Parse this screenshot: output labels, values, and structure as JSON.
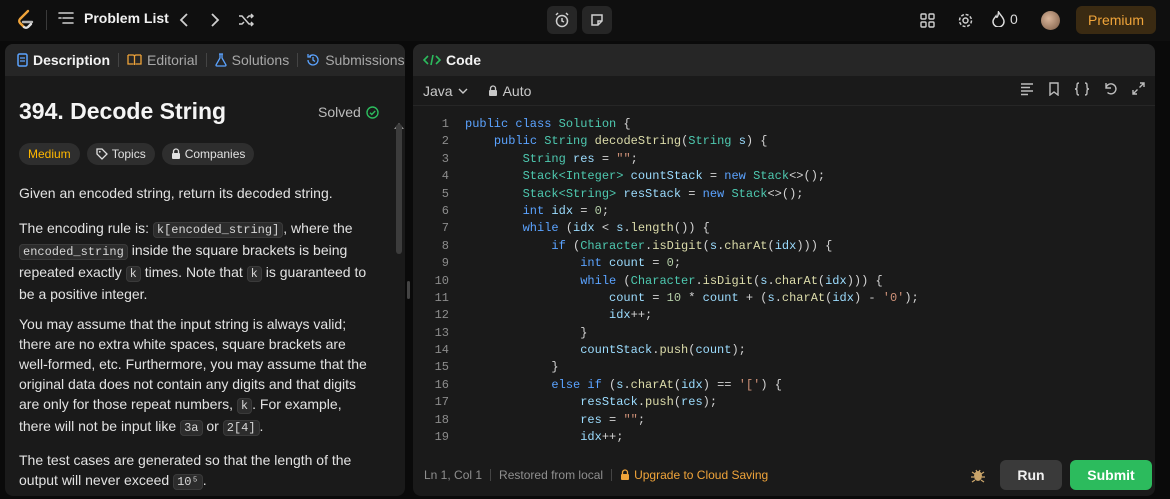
{
  "topbar": {
    "problem_list_label": "Problem List",
    "streak_count": "0",
    "premium_label": "Premium"
  },
  "left_tabs": {
    "description": "Description",
    "editorial": "Editorial",
    "solutions": "Solutions",
    "submissions": "Submissions"
  },
  "problem": {
    "title": "394. Decode String",
    "status": "Solved",
    "difficulty": "Medium",
    "topics_label": "Topics",
    "companies_label": "Companies",
    "p1": "Given an encoded string, return its decoded string.",
    "p2_a": "The encoding rule is: ",
    "p2_code1": "k[encoded_string]",
    "p2_b": ", where the ",
    "p2_code2": "encoded_string",
    "p2_c": " inside the square brackets is being repeated exactly ",
    "p2_code3": "k",
    "p2_d": " times. Note that ",
    "p2_code4": "k",
    "p2_e": " is guaranteed to be a positive integer.",
    "p3_a": "You may assume that the input string is always valid; there are no extra white spaces, square brackets are well-formed, etc. Furthermore, you may assume that the original data does not contain any digits and that digits are only for those repeat numbers, ",
    "p3_code1": "k",
    "p3_b": ". For example, there will not be input like ",
    "p3_code2": "3a",
    "p3_c": " or ",
    "p3_code3": "2[4]",
    "p3_d": ".",
    "p4_a": "The test cases are generated so that the length of the output will never exceed ",
    "p4_code": "10⁵",
    "p4_b": "."
  },
  "editor": {
    "tab_label": "Code",
    "language": "Java",
    "mode": "Auto",
    "line_numbers": [
      "1",
      "2",
      "3",
      "4",
      "5",
      "6",
      "7",
      "8",
      "9",
      "10",
      "11",
      "12",
      "13",
      "14",
      "15",
      "16",
      "17",
      "18",
      "19"
    ]
  },
  "status_bar": {
    "position": "Ln 1, Col 1",
    "restored": "Restored from local",
    "upgrade": "Upgrade to Cloud Saving",
    "run_label": "Run",
    "submit_label": "Submit"
  },
  "colors": {
    "accent_green": "#2cbb5d",
    "medium_yellow": "#ffb800",
    "premium_orange": "#f0a43a"
  },
  "icons": [
    "logo-icon",
    "list-icon",
    "chevron-left-icon",
    "chevron-right-icon",
    "shuffle-icon",
    "alarm-icon",
    "note-icon",
    "grid-icon",
    "gear-icon",
    "flame-icon",
    "description-icon",
    "editorial-icon",
    "solutions-icon",
    "submissions-icon",
    "check-circle-icon",
    "tag-icon",
    "lock-icon",
    "code-icon",
    "chevron-down-icon",
    "format-icon",
    "bookmark-icon",
    "braces-icon",
    "undo-icon",
    "expand-icon",
    "bug-icon"
  ]
}
